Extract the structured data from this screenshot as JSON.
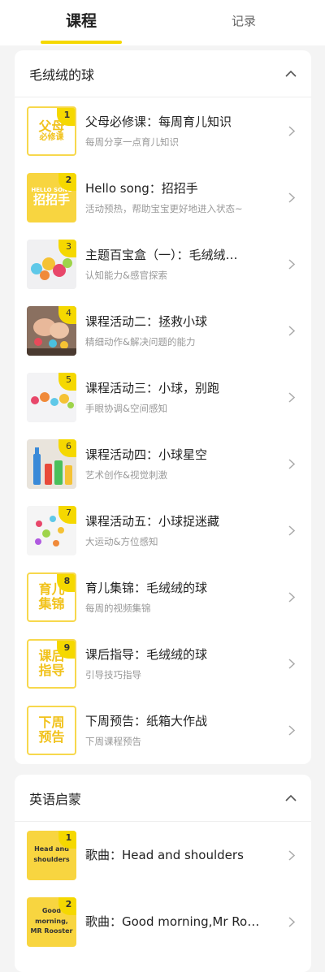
{
  "tabs": [
    {
      "label": "课程",
      "active": true
    },
    {
      "label": "记录",
      "active": false
    }
  ],
  "colors": {
    "accent": "#f5d800",
    "thumb_yellow": "#f8d540",
    "background": "#f4f4f4"
  },
  "sections": [
    {
      "title": "毛绒绒的球",
      "collapse_icon": "chevron-up-icon",
      "items": [
        {
          "badge": "1",
          "thumb_text": [
            "父母",
            "必修课"
          ],
          "title": "父母必修课：每周育儿知识",
          "subtitle": "每周分享一点育儿知识"
        },
        {
          "badge": "2",
          "thumb_text": [
            "HELLO SONG",
            "招招手"
          ],
          "title": "Hello song：招招手",
          "subtitle": "活动预热，帮助宝宝更好地进入状态~"
        },
        {
          "badge": "3",
          "thumb_image": "colorful-pompom-balls",
          "title": "主题百宝盒（一）：毛绒绒…",
          "subtitle": "认知能力&感官探索"
        },
        {
          "badge": "4",
          "thumb_image": "child-hands-playing-balls",
          "title": "课程活动二：拯救小球",
          "subtitle": "精细动作&解决问题的能力"
        },
        {
          "badge": "5",
          "thumb_image": "pompom-balls-rolling",
          "title": "课程活动三：小球，别跑",
          "subtitle": "手眼协调&空间感知"
        },
        {
          "badge": "6",
          "thumb_image": "colored-bottles",
          "title": "课程活动四：小球星空",
          "subtitle": "艺术创作&视觉刺激"
        },
        {
          "badge": "7",
          "thumb_image": "scattered-pompoms",
          "title": "课程活动五：小球捉迷藏",
          "subtitle": "大运动&方位感知"
        },
        {
          "badge": "8",
          "thumb_text": [
            "育儿",
            "集锦"
          ],
          "title": "育儿集锦：毛绒绒的球",
          "subtitle": "每周的视频集锦"
        },
        {
          "badge": "9",
          "thumb_text": [
            "课后",
            "指导"
          ],
          "title": "课后指导：毛绒绒的球",
          "subtitle": "引导技巧指导"
        },
        {
          "badge": "",
          "thumb_text": [
            "下周",
            "预告"
          ],
          "title": "下周预告：纸箱大作战",
          "subtitle": "下周课程预告"
        }
      ]
    },
    {
      "title": "英语启蒙",
      "collapse_icon": "chevron-up-icon",
      "items": [
        {
          "badge": "1",
          "thumb_text": [
            "Head and",
            "shoulders"
          ],
          "title": "歌曲：Head and shoulders",
          "subtitle": ""
        },
        {
          "badge": "2",
          "thumb_text": [
            "Good morning,",
            "MR Rooster"
          ],
          "title": "歌曲：Good morning,Mr Ro…",
          "subtitle": ""
        }
      ]
    }
  ]
}
